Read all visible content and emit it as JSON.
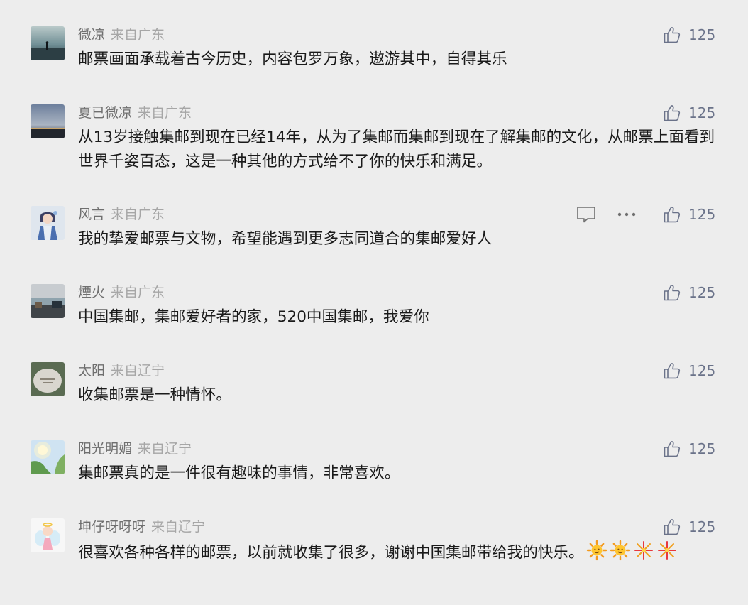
{
  "colors": {
    "background": "#ededed",
    "nickname": "#6f6f6f",
    "location": "#a6a6a6",
    "body_text": "#1a1a1a",
    "like": "#6a7289"
  },
  "comments": [
    {
      "nickname": "微凉",
      "location": "来自广东",
      "text": "邮票画面承载着古今历史，内容包罗万象，遨游其中，自得其乐",
      "likes": "125",
      "avatar": "seaside-silhouette-dusk"
    },
    {
      "nickname": "夏已微凉",
      "location": "来自广东",
      "text": "从13岁接触集邮到现在已经14年，从为了集邮而集邮到现在了解集邮的文化，从邮票上面看到世界千姿百态，这是一种其他的方式给不了你的快乐和满足。",
      "likes": "125",
      "avatar": "bridge-evening-sky"
    },
    {
      "nickname": "风言",
      "location": "来自广东",
      "text": "我的挚爱邮票与文物，希望能遇到更多志同道合的集邮爱好人",
      "likes": "125",
      "avatar": "anime-character",
      "actions": [
        {
          "icon": "comment-bubble-icon"
        },
        {
          "icon": "more-options-icon"
        }
      ]
    },
    {
      "nickname": "煙火",
      "location": "来自广东",
      "text": "中国集邮，集邮爱好者的家，520中国集邮，我爱你",
      "likes": "125",
      "avatar": "seaside-terrace"
    },
    {
      "nickname": "太阳",
      "location": "来自辽宁",
      "text": "收集邮票是一种情怀。",
      "likes": "125",
      "avatar": "engraved-stone"
    },
    {
      "nickname": "阳光明媚",
      "location": "来自辽宁",
      "text": "集邮票真的是一件很有趣味的事情，非常喜欢。",
      "likes": "125",
      "avatar": "sunlight-leaves"
    },
    {
      "nickname": "坤仔呀呀呀",
      "location": "来自辽宁",
      "text": "很喜欢各种各样的邮票，以前就收集了很多，谢谢中国集邮带给我的快乐。",
      "likes": "125",
      "avatar": "cartoon-angel",
      "emojis": [
        "sun-emoji",
        "sun-emoji",
        "firework-emoji",
        "firework-emoji"
      ]
    }
  ]
}
